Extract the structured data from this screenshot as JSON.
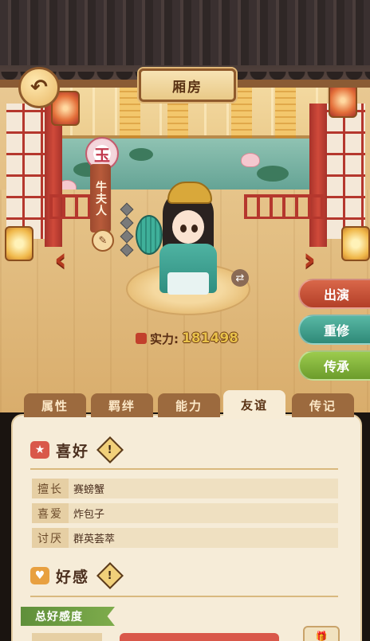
{
  "header": {
    "title": "厢房",
    "back_icon": "↶"
  },
  "character": {
    "rank_badge": "玉",
    "name": "牛夫人",
    "edit_icon": "✎",
    "swap_icon": "⇄",
    "power_label": "实力:",
    "power_value": "181498",
    "power_icon": "👍"
  },
  "nav": {
    "prev": "‹",
    "next": "›"
  },
  "actions": [
    {
      "label": "出演"
    },
    {
      "label": "重修"
    },
    {
      "label": "传承"
    }
  ],
  "tabs": [
    {
      "label": "属性",
      "active": false
    },
    {
      "label": "羁绊",
      "active": false
    },
    {
      "label": "能力",
      "active": false
    },
    {
      "label": "友谊",
      "active": true
    },
    {
      "label": "传记",
      "active": false
    }
  ],
  "preferences": {
    "title": "喜好",
    "info": "!",
    "rows": [
      {
        "key": "擅长",
        "value": "赛螃蟹"
      },
      {
        "key": "喜爱",
        "value": "炸包子"
      },
      {
        "key": "讨厌",
        "value": "群英荟萃"
      }
    ]
  },
  "affection": {
    "title": "好感",
    "info": "!",
    "total_label": "总好感度"
  },
  "colors": {
    "accent_red": "#b53a20",
    "teal": "#2f8a78",
    "green": "#6c9c2c",
    "panel": "#f6ecd8"
  }
}
